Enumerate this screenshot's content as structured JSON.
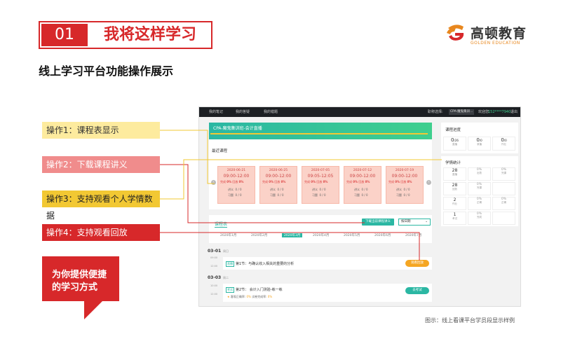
{
  "header": {
    "number": "01",
    "title": "我将这样学习"
  },
  "logo": {
    "name_cn": "高顿教育",
    "name_en": "GOLDEN EDUCATION",
    "accent": "#e8871e"
  },
  "section_title": "线上学习平台功能操作展示",
  "operations": [
    {
      "label": "操作1：课程表显示"
    },
    {
      "label": "操作2：下载课程讲义"
    },
    {
      "label": "操作3：支持观看个人学情数据"
    },
    {
      "label": "操作4：支持观看回放"
    }
  ],
  "callout": {
    "line1": "为你提供便捷",
    "line2": "的学习方式"
  },
  "caption": "图示：线上看课平台学员段显示样例",
  "colors": {
    "brand_red": "#d7282a",
    "teal": "#2bb7a3",
    "yellow": "#f2c833"
  },
  "screenshot": {
    "topbar": {
      "items": [
        "我的笔记",
        "我的答疑",
        "我的错题"
      ],
      "switch_label": "职称选择:",
      "select_value": "CPA-魔鬼集训...",
      "welcome": "欢迎您,",
      "phone": "152****7940",
      "logout": "退出"
    },
    "course_title": "CPA-魔鬼集训班-会计直播",
    "recent_label": "最近课程",
    "cards": [
      {
        "date": "2020-06-21",
        "time": "09:00-12:00",
        "done_label": "完成",
        "done": "0%",
        "review_label": "回放",
        "review": "0%",
        "r1_label": "讲义",
        "r1": "0 / 0",
        "r2_label": "习题",
        "r2": "0 / 0"
      },
      {
        "date": "2020-06-25",
        "time": "09:00-12:00",
        "done_label": "完成",
        "done": "0%",
        "review_label": "回放",
        "review": "0%",
        "r1_label": "讲义",
        "r1": "0 / 0",
        "r2_label": "习题",
        "r2": "0 / 0"
      },
      {
        "date": "2020-07-05",
        "time": "09:05-12:05",
        "done_label": "完成",
        "done": "0%",
        "review_label": "回放",
        "review": "0%",
        "r1_label": "讲义",
        "r1": "0 / 0",
        "r2_label": "习题",
        "r2": "0 / 0"
      },
      {
        "date": "2020-07-12",
        "time": "09:00-12:00",
        "done_label": "完成",
        "done": "0%",
        "review_label": "回放",
        "review": "0%",
        "r1_label": "讲义",
        "r1": "0 / 0",
        "r2_label": "习题",
        "r2": "0 / 0"
      },
      {
        "date": "2020-07-19",
        "time": "09:00-12:00",
        "done_label": "完成",
        "done": "0%",
        "review_label": "回放",
        "review": "0%",
        "r1_label": "讲义",
        "r1": "0 / 0",
        "r2_label": "习题",
        "r2": "0 / 0"
      }
    ],
    "progress": {
      "title": "课程进度",
      "cells": [
        {
          "value": "0",
          "unit": "/26",
          "label": "直播"
        },
        {
          "value": "0",
          "unit": "/0",
          "label": "录播"
        },
        {
          "value": "0",
          "unit": "/0",
          "label": "作业"
        }
      ]
    },
    "study": {
      "title": "学情统计",
      "rows": [
        {
          "count": "28",
          "label": "直播",
          "a": "0%",
          "a_label": "出勤",
          "b": "0%",
          "b_label": "完课"
        },
        {
          "count": "28",
          "label": "回放",
          "a": "0%",
          "a_label": "完课",
          "b": "",
          "b_label": ""
        },
        {
          "count": "2",
          "label": "作业",
          "a": "0%",
          "a_label": "正确",
          "b": "0%",
          "b_label": "正确"
        },
        {
          "count": "1",
          "label": "考试",
          "a": "0%",
          "a_label": "完成",
          "b": "",
          "b_label": ""
        }
      ]
    },
    "schedule": {
      "tab": "课程表",
      "download": "下载当前课程讲义",
      "select": "按日期",
      "months": [
        "2020年1月",
        "2020年2月",
        "2020年3月",
        "2020年4月",
        "2020年5月",
        "2020年6月",
        "2020年7月"
      ],
      "active_month": "2020年3月"
    },
    "days": [
      {
        "date": "03-01",
        "weekday": "周日",
        "time1": "09:00",
        "time2": "12:00",
        "tag": "直播",
        "lesson": "第1节：与确认收入相关的重要的分析",
        "action": "观看回放"
      },
      {
        "date": "03-03",
        "weekday": "周二",
        "time1": "10:00",
        "time2": "12:00",
        "tag": "考试",
        "lesson": "第2节：  会计入门测验-练一练",
        "stat1_label": "客观正确率:",
        "stat1": "0%",
        "stat2_label": "试卷完成率:",
        "stat2": "0%",
        "action": "去考试"
      }
    ]
  }
}
